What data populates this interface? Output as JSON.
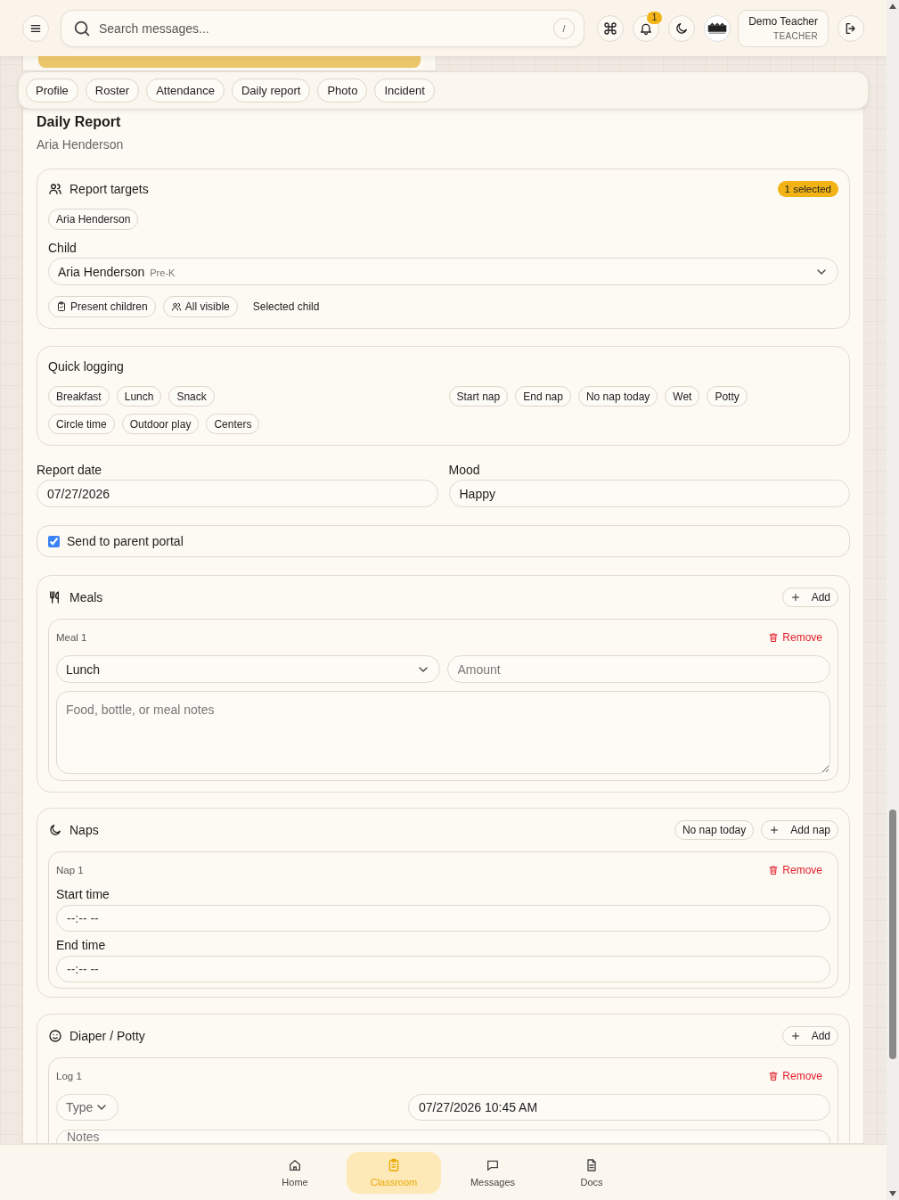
{
  "header": {
    "search": {
      "placeholder": "Search messages...",
      "shortcut": "/"
    },
    "notifications": {
      "count": "1"
    },
    "user": {
      "name": "Demo Teacher",
      "role": "TEACHER"
    }
  },
  "tabs": [
    {
      "label": "Profile",
      "selected": false
    },
    {
      "label": "Roster",
      "selected": false
    },
    {
      "label": "Attendance",
      "selected": false
    },
    {
      "label": "Daily report",
      "selected": false
    },
    {
      "label": "Photo",
      "selected": false
    },
    {
      "label": "Incident",
      "selected": false
    }
  ],
  "report": {
    "title": "Daily Report",
    "subtitle": "Aria Henderson"
  },
  "targets": {
    "title": "Report targets",
    "badge": "1 selected",
    "chips": [
      "Aria Henderson"
    ],
    "child_label": "Child",
    "child": {
      "value": "Aria Henderson",
      "tag": "Pre-K"
    },
    "filters": [
      {
        "label": "Present children",
        "kind": "present"
      },
      {
        "label": "All visible",
        "kind": "all"
      },
      {
        "label": "Selected child",
        "kind": "text"
      }
    ]
  },
  "quick_logging": {
    "title": "Quick logging",
    "groups": [
      [
        "Breakfast",
        "Lunch",
        "Snack"
      ],
      [
        "Start nap",
        "End nap",
        "No nap today",
        "Wet",
        "Potty"
      ],
      [
        "Circle time",
        "Outdoor play",
        "Centers"
      ]
    ]
  },
  "report_date": {
    "label": "Report date",
    "value": "07/27/2026"
  },
  "mood": {
    "label": "Mood",
    "value": "Happy"
  },
  "send_to_parent": {
    "label": "Send to parent portal",
    "checked": true
  },
  "meals": {
    "title": "Meals",
    "add": "Add",
    "items": [
      {
        "title": "Meal 1",
        "remove": "Remove",
        "type": "Lunch",
        "amount_placeholder": "Amount",
        "notes_placeholder": "Food, bottle, or meal notes"
      }
    ]
  },
  "naps": {
    "title": "Naps",
    "extra_button": "No nap today",
    "add": "Add nap",
    "items": [
      {
        "title": "Nap 1",
        "remove": "Remove",
        "start_label": "Start time",
        "start_value": "--:-- --",
        "end_label": "End time",
        "end_value": "--:-- --"
      }
    ]
  },
  "diaper": {
    "title": "Diaper / Potty",
    "add": "Add",
    "items": [
      {
        "title": "Log 1",
        "remove": "Remove",
        "type_placeholder": "Type",
        "time": "07/27/2026 10:45 AM",
        "notes_placeholder": "Notes"
      }
    ]
  },
  "bottom_nav": [
    {
      "label": "Home",
      "kind": "home",
      "selected": false
    },
    {
      "label": "Classroom",
      "kind": "classroom",
      "selected": true
    },
    {
      "label": "Messages",
      "kind": "messages",
      "selected": false
    },
    {
      "label": "Docs",
      "kind": "docs",
      "selected": false
    }
  ]
}
